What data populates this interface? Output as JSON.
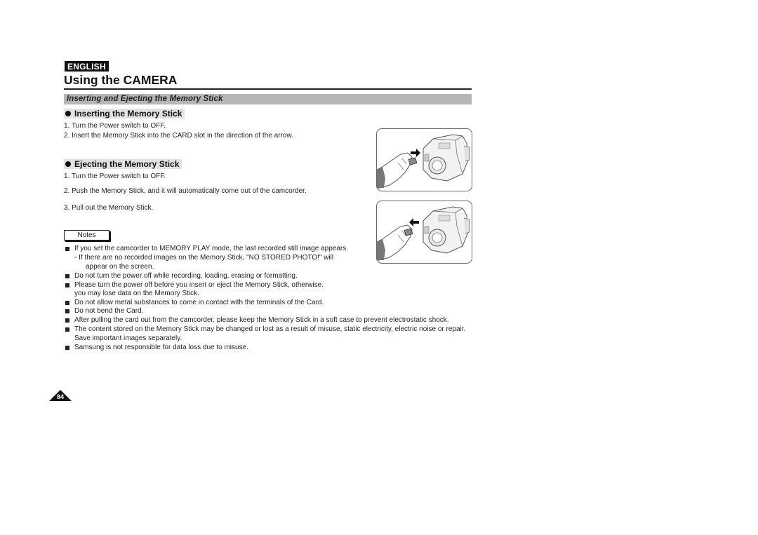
{
  "header": {
    "language_badge": "ENGLISH",
    "page_title": "Using the CAMERA"
  },
  "section": {
    "title": "Inserting and Ejecting the Memory Stick"
  },
  "inserting": {
    "heading": "Inserting the Memory Stick",
    "steps": [
      "1.  Turn the Power switch to OFF.",
      "2.  Insert the Memory Stick into the CARD slot in the direction of the arrow."
    ]
  },
  "ejecting": {
    "heading": "Ejecting the Memory Stick",
    "steps": [
      "1.  Turn the Power switch to OFF.",
      "2.  Push the Memory Stick, and it will automatically come out of the camcorder.",
      "3.  Pull out the Memory Stick."
    ]
  },
  "notes": {
    "label": "Notes",
    "items": [
      "If you set the camcorder to MEMORY PLAY mode, the last recorded still image appears.",
      "-   If there are no recorded images on the Memory Stick, \"NO STORED PHOTO!\" will",
      "appear on the screen.",
      "Do not turn the power off while recording, loading, erasing or formatting.",
      "Please turn the power off before you insert or eject the Memory Stick, otherwise.",
      "you may lose data on the Memory Stick.",
      "Do not allow metal substances to come in contact with the terminals of the Card.",
      "Do not bend the Card.",
      "After pulling the card out from the camcorder, please keep the Memory Stick in a soft case to prevent electrostatic shock.",
      "The content stored on the Memory Stick may be changed or lost as a result of misuse, static electricity, electric noise or repair.",
      "Save important images separately.",
      "Samsung is not responsible for data loss due to misuse."
    ]
  },
  "illustrations": {
    "insert_icon": "camcorder-insert-illustration",
    "eject_icon": "camcorder-eject-illustration"
  },
  "footer": {
    "page_number": "84"
  }
}
